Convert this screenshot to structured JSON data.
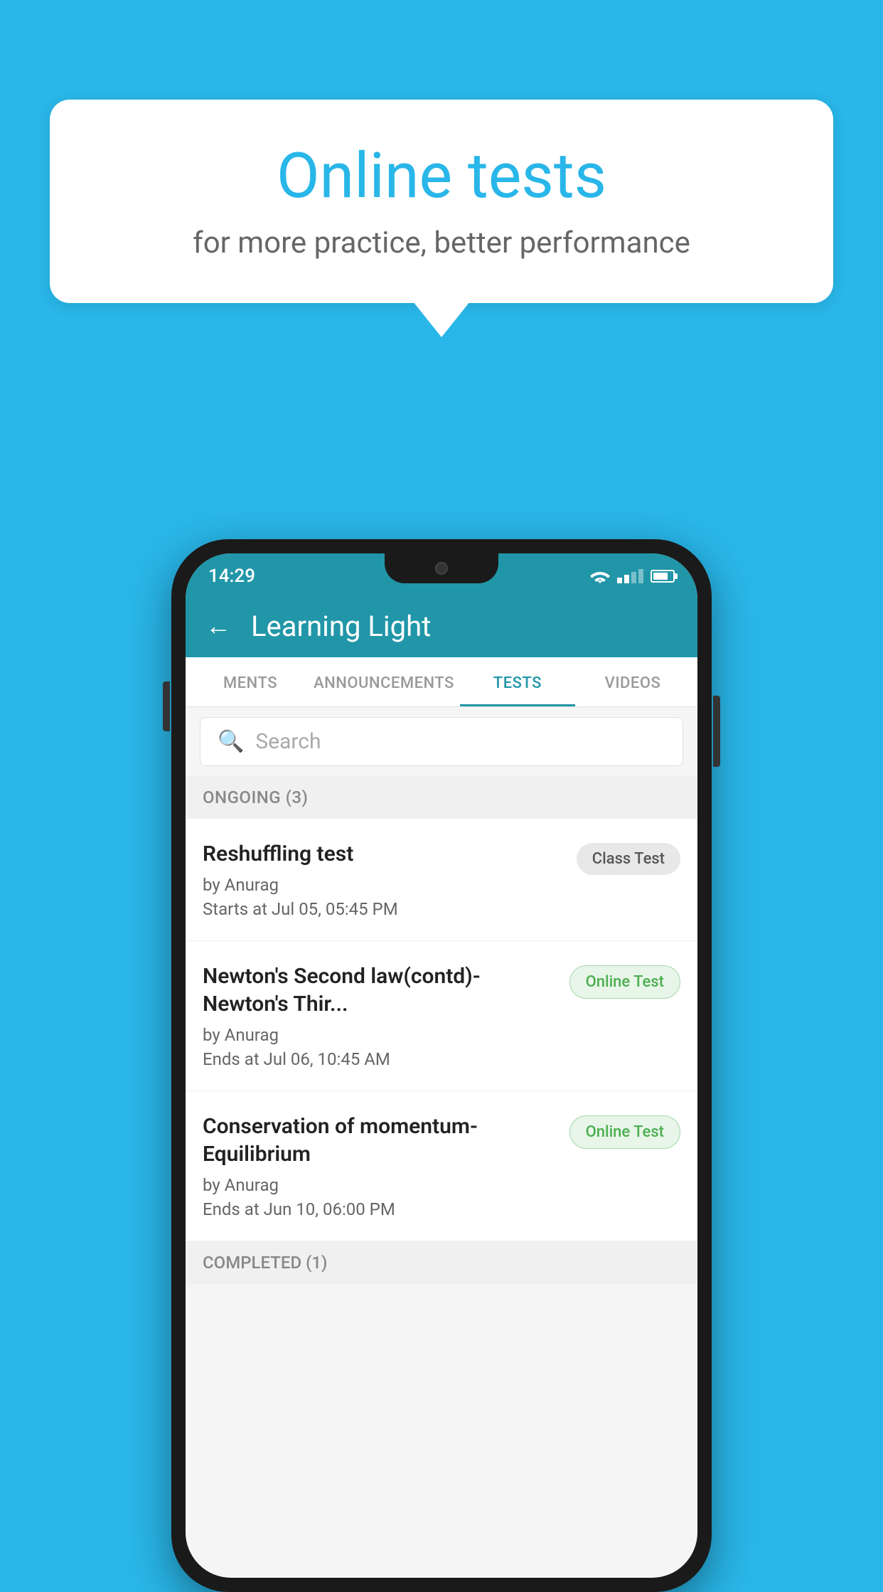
{
  "background_color": "#29b6e8",
  "bubble": {
    "title": "Online tests",
    "subtitle": "for more practice, better performance"
  },
  "status_bar": {
    "time": "14:29"
  },
  "app_bar": {
    "title": "Learning Light",
    "back_label": "←"
  },
  "tabs": [
    {
      "label": "MENTS",
      "active": false
    },
    {
      "label": "ANNOUNCEMENTS",
      "active": false
    },
    {
      "label": "TESTS",
      "active": true
    },
    {
      "label": "VIDEOS",
      "active": false
    }
  ],
  "search": {
    "placeholder": "Search"
  },
  "ongoing_section": {
    "label": "ONGOING (3)"
  },
  "tests": [
    {
      "title": "Reshuffling test",
      "by": "by Anurag",
      "date": "Starts at  Jul 05, 05:45 PM",
      "badge": "Class Test",
      "badge_type": "class"
    },
    {
      "title": "Newton's Second law(contd)-Newton's Thir...",
      "by": "by Anurag",
      "date": "Ends at  Jul 06, 10:45 AM",
      "badge": "Online Test",
      "badge_type": "online"
    },
    {
      "title": "Conservation of momentum-Equilibrium",
      "by": "by Anurag",
      "date": "Ends at  Jun 10, 06:00 PM",
      "badge": "Online Test",
      "badge_type": "online"
    }
  ],
  "completed_section": {
    "label": "COMPLETED (1)"
  }
}
